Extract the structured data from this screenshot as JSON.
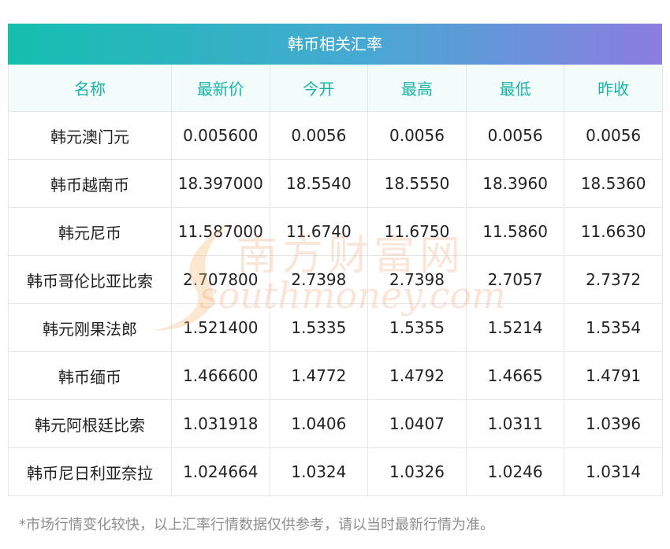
{
  "title": "韩币相关汇率",
  "headers": [
    "名称",
    "最新价",
    "今开",
    "最高",
    "最低",
    "昨收"
  ],
  "rows": [
    [
      "韩元澳门元",
      "0.005600",
      "0.0056",
      "0.0056",
      "0.0056",
      "0.0056"
    ],
    [
      "韩币越南币",
      "18.397000",
      "18.5540",
      "18.5550",
      "18.3960",
      "18.5360"
    ],
    [
      "韩元尼币",
      "11.587000",
      "11.6740",
      "11.6750",
      "11.5860",
      "11.6630"
    ],
    [
      "韩币哥伦比亚比索",
      "2.707800",
      "2.7398",
      "2.7398",
      "2.7057",
      "2.7372"
    ],
    [
      "韩元刚果法郎",
      "1.521400",
      "1.5335",
      "1.5355",
      "1.5214",
      "1.5354"
    ],
    [
      "韩币缅币",
      "1.466600",
      "1.4772",
      "1.4792",
      "1.4665",
      "1.4791"
    ],
    [
      "韩元阿根廷比索",
      "1.031918",
      "1.0406",
      "1.0407",
      "1.0311",
      "1.0396"
    ],
    [
      "韩币尼日利亚奈拉",
      "1.024664",
      "1.0324",
      "1.0326",
      "1.0246",
      "1.0314"
    ]
  ],
  "watermark": {
    "cn": "南方财富网",
    "en": "southmoney.com"
  },
  "footnote": "*市场行情变化较快，以上汇率行情数据仅供参考，请以当时最新行情为准。",
  "colors": {
    "header_text": "#18b3a6",
    "header_bg": "#f1fcfb",
    "title_gradient_start": "#14bfae",
    "title_gradient_end": "#8c7de0"
  }
}
